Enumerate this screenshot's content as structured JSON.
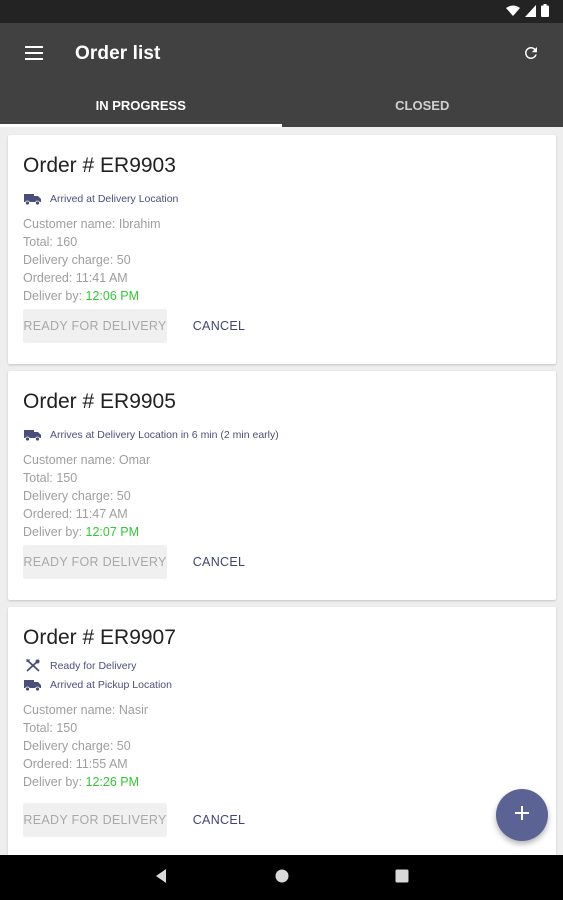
{
  "app": {
    "title": "Order list"
  },
  "tabs": [
    {
      "label": "IN PROGRESS",
      "active": true
    },
    {
      "label": "CLOSED",
      "active": false
    }
  ],
  "colors": {
    "appbar": "#414141",
    "accent": "#5b6394",
    "status_text": "#4a4f7a",
    "green_time": "#32c832"
  },
  "icons": {
    "menu": "menu-icon",
    "refresh": "refresh-icon",
    "truck": "truck-icon",
    "utensils": "utensils-icon",
    "add": "add-icon",
    "back": "back-icon",
    "home": "home-icon",
    "recents": "recents-icon",
    "wifi": "wifi-icon",
    "signal": "signal-icon",
    "battery": "battery-icon"
  },
  "orders": [
    {
      "title": "Order # ER9903",
      "statuses": [
        {
          "icon": "truck-icon",
          "text": "Arrived at Delivery Location"
        }
      ],
      "customer": "Customer name: Ibrahim",
      "total": "Total: 160",
      "delivery_charge": "Delivery charge: 50",
      "ordered": "Ordered: 11:41 AM",
      "deliver_by_label": "Deliver by:",
      "deliver_by_time": "12:06 PM",
      "ready_label": "READY FOR DELIVERY",
      "cancel_label": "CANCEL"
    },
    {
      "title": "Order # ER9905",
      "statuses": [
        {
          "icon": "truck-icon",
          "text": "Arrives at Delivery Location in 6 min (2 min early)"
        }
      ],
      "customer": "Customer name: Omar",
      "total": "Total: 150",
      "delivery_charge": "Delivery charge: 50",
      "ordered": "Ordered: 11:47 AM",
      "deliver_by_label": "Deliver by:",
      "deliver_by_time": "12:07 PM",
      "ready_label": "READY FOR DELIVERY",
      "cancel_label": "CANCEL"
    },
    {
      "title": "Order # ER9907",
      "statuses": [
        {
          "icon": "utensils-icon",
          "text": "Ready for Delivery"
        },
        {
          "icon": "truck-icon",
          "text": "Arrived at Pickup Location"
        }
      ],
      "customer": "Customer name: Nasir",
      "total": "Total: 150",
      "delivery_charge": "Delivery charge: 50",
      "ordered": "Ordered: 11:55 AM",
      "deliver_by_label": "Deliver by:",
      "deliver_by_time": "12:26 PM",
      "ready_label": "READY FOR DELIVERY",
      "cancel_label": "CANCEL"
    }
  ]
}
